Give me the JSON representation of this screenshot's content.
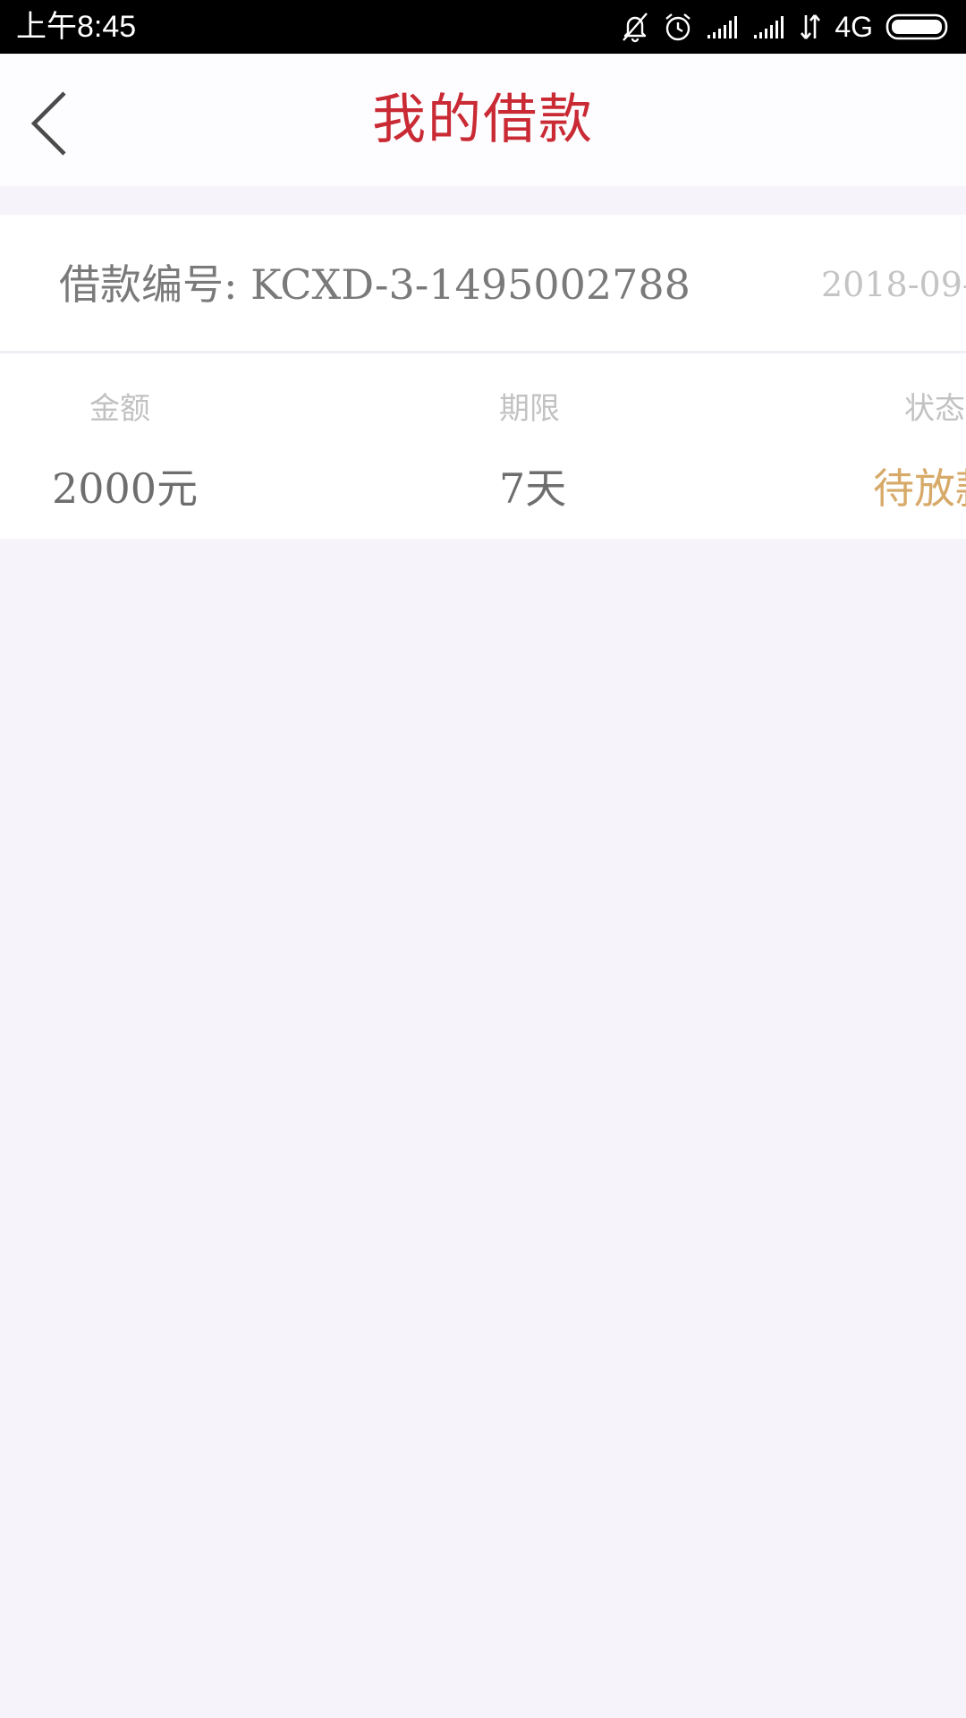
{
  "status_bar": {
    "time": "上午8:45",
    "network": "4G",
    "icons": [
      "bell-off-icon",
      "alarm-icon",
      "signal-icon",
      "signal-icon",
      "data-arrows-icon",
      "battery-icon"
    ]
  },
  "header": {
    "title": "我的借款"
  },
  "loan": {
    "number": "借款编号: KCXD-3-1495002788",
    "date": "2018-09-",
    "fields": {
      "amount_label": "金额",
      "amount_value": "2000元",
      "term_label": "期限",
      "term_value": "7天",
      "status_label": "状态",
      "status_value": "待放款"
    }
  },
  "colors": {
    "accent": "#c92a34",
    "status": "#d7aa69",
    "background": "#f6f4fa"
  }
}
